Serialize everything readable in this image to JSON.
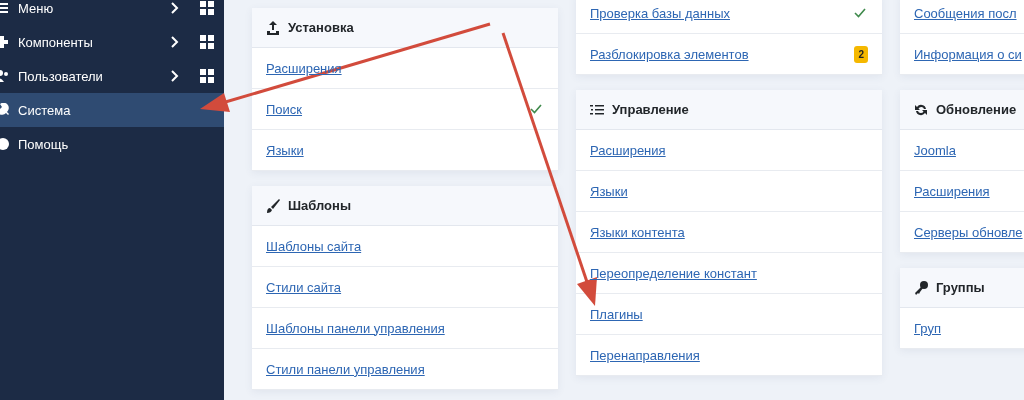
{
  "sidebar": {
    "items": [
      {
        "label": "Меню",
        "selected": false,
        "submenu": true
      },
      {
        "label": "Компоненты",
        "selected": false,
        "submenu": true
      },
      {
        "label": "Пользователи",
        "selected": false,
        "submenu": true
      },
      {
        "label": "Система",
        "selected": true,
        "submenu": false
      },
      {
        "label": "Помощь",
        "selected": false,
        "submenu": false
      }
    ]
  },
  "columns": [
    {
      "cards": [
        {
          "title": "Установка",
          "links": [
            {
              "label": "Расширения"
            },
            {
              "label": "Поиск",
              "check": true
            },
            {
              "label": "Языки"
            }
          ]
        },
        {
          "title": "Шаблоны",
          "links": [
            {
              "label": "Шаблоны сайта"
            },
            {
              "label": "Стили сайта"
            },
            {
              "label": "Шаблоны панели управления"
            },
            {
              "label": "Стили панели управления"
            }
          ]
        }
      ]
    },
    {
      "cards": [
        {
          "links": [
            {
              "label": "Проверка базы данных",
              "check": true
            },
            {
              "label": "Разблокировка элементов",
              "badge": "2"
            }
          ]
        },
        {
          "title": "Управление",
          "links": [
            {
              "label": "Расширения"
            },
            {
              "label": "Языки"
            },
            {
              "label": "Языки контента"
            },
            {
              "label": "Переопределение констант"
            },
            {
              "label": "Плагины"
            },
            {
              "label": "Перенаправления"
            }
          ]
        }
      ]
    },
    {
      "cards": [
        {
          "links": [
            {
              "label": "Сообщения посл"
            },
            {
              "label": "Информация о си"
            }
          ]
        },
        {
          "title": "Обновление",
          "links": [
            {
              "label": "Joomla"
            },
            {
              "label": "Расширения"
            },
            {
              "label": "Серверы обновле"
            }
          ]
        },
        {
          "title": "Группы",
          "links": [
            {
              "label": "Груп"
            }
          ]
        }
      ]
    }
  ]
}
